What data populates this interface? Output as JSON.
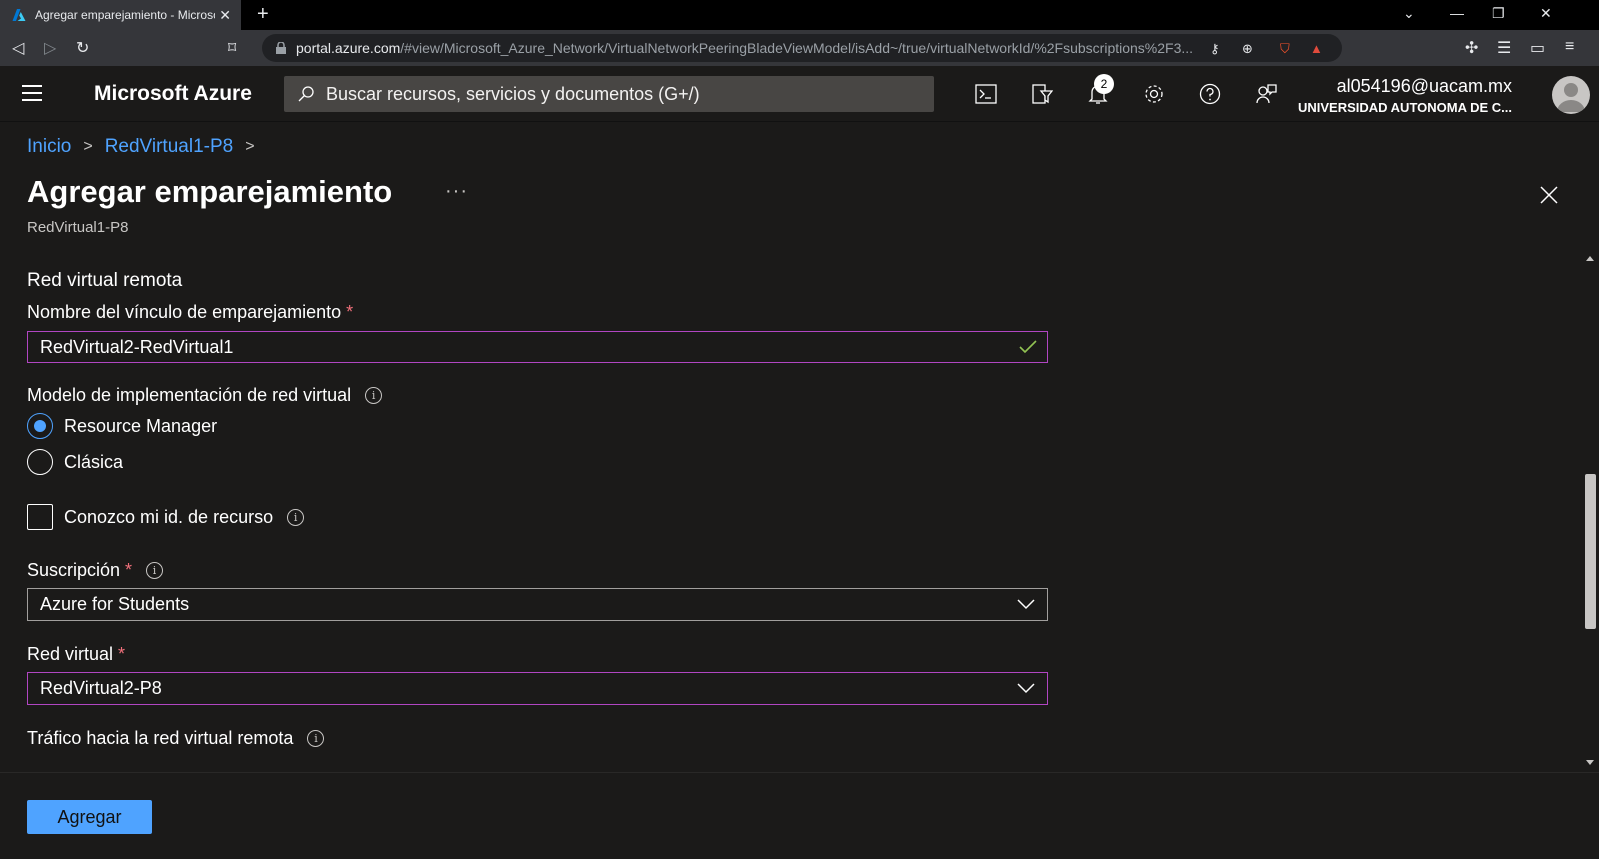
{
  "browser": {
    "tab_title": "Agregar emparejamiento - Microsoft Azure",
    "url_host": "portal.azure.com",
    "url_path": "/#view/Microsoft_Azure_Network/VirtualNetworkPeeringBladeViewModel/isAdd~/true/virtualNetworkId/%2Fsubscriptions%2F3..."
  },
  "header": {
    "brand": "Microsoft Azure",
    "search_placeholder": "Buscar recursos, servicios y documentos (G+/)",
    "notifications_count": "2",
    "user_email": "al054196@uacam.mx",
    "user_org": "UNIVERSIDAD AUTONOMA DE C..."
  },
  "breadcrumb": {
    "items": [
      "Inicio",
      "RedVirtual1-P8"
    ]
  },
  "page": {
    "title": "Agregar emparejamiento",
    "more": "···",
    "subtitle": "RedVirtual1-P8"
  },
  "form": {
    "section_title": "Red virtual remota",
    "peering_name_label": "Nombre del vínculo de emparejamiento",
    "peering_name_value": "RedVirtual2-RedVirtual1",
    "deployment_model_label": "Modelo de implementación de red virtual",
    "deployment_options": [
      "Resource Manager",
      "Clásica"
    ],
    "selected_deployment": "Resource Manager",
    "resource_id_checkbox_label": "Conozco mi id. de recurso",
    "subscription_label": "Suscripción",
    "subscription_value": "Azure for Students",
    "vnet_label": "Red virtual",
    "vnet_value": "RedVirtual2-P8",
    "traffic_label": "Tráfico hacia la red virtual remota",
    "required_marker": "*"
  },
  "footer": {
    "add_button": "Agregar"
  },
  "colors": {
    "accent": "#4fa3ff",
    "focus_border": "#b146c2",
    "required": "#f1707b",
    "valid_check": "#92c353"
  }
}
